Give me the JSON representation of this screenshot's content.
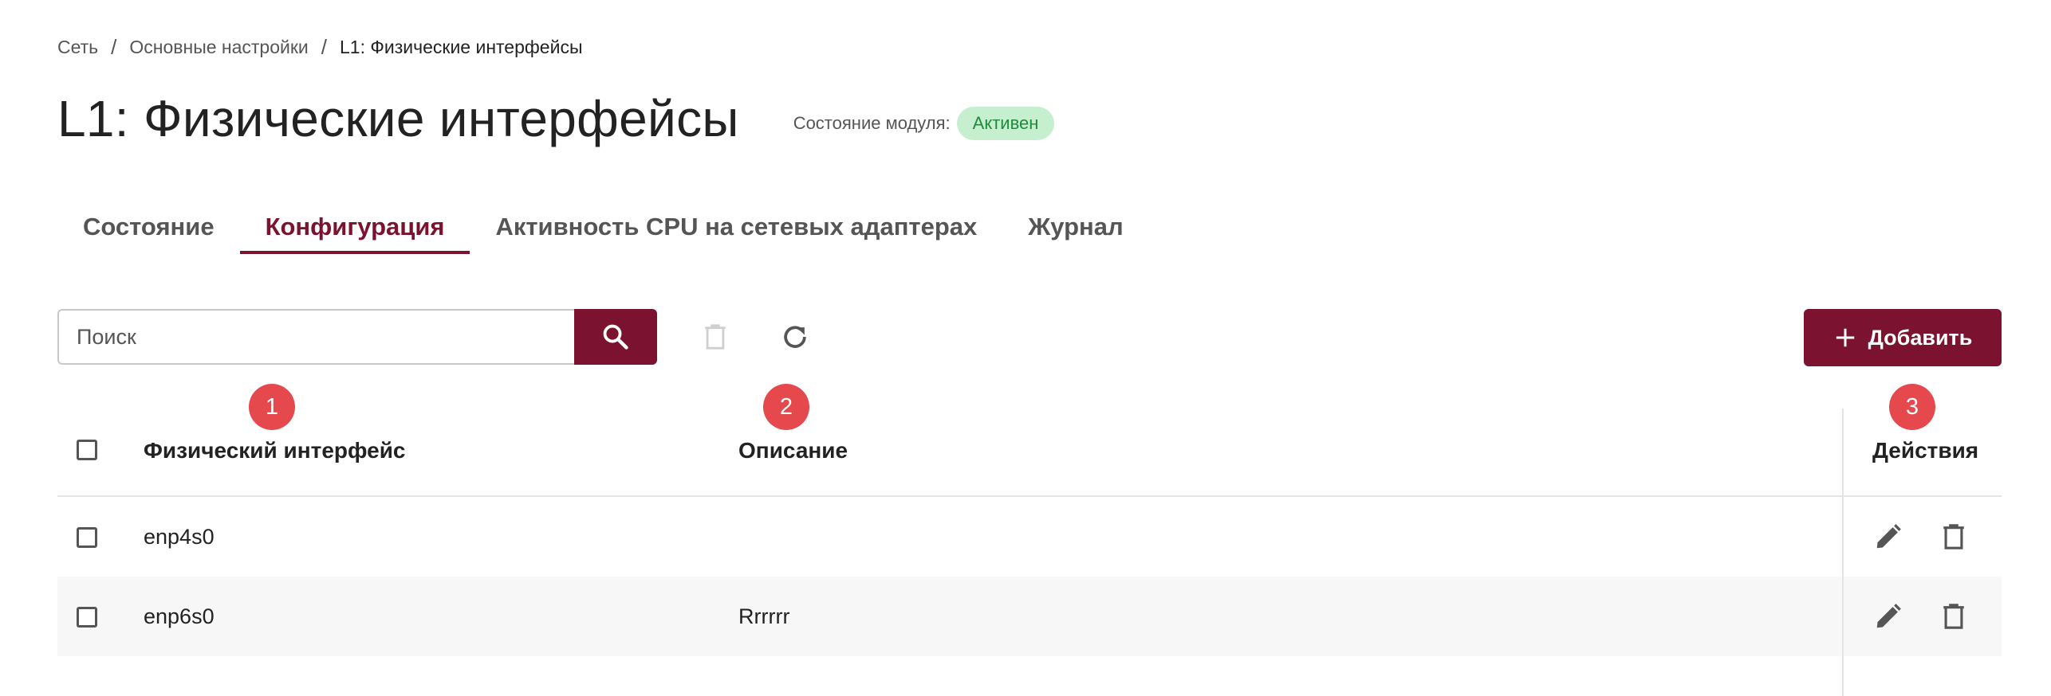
{
  "breadcrumb": {
    "item1": "Сеть",
    "sep": "/",
    "item2": "Основные настройки",
    "current": "L1: Физические интерфейсы"
  },
  "header": {
    "title": "L1: Физические интерфейсы",
    "module_state_label": "Состояние модуля:",
    "module_state_value": "Активен"
  },
  "tabs": [
    {
      "label": "Состояние",
      "active": false
    },
    {
      "label": "Конфигурация",
      "active": true
    },
    {
      "label": "Активность CPU на сетевых адаптерах",
      "active": false
    },
    {
      "label": "Журнал",
      "active": false
    }
  ],
  "toolbar": {
    "search_placeholder": "Поиск",
    "search_icon": "search-icon",
    "delete_icon": "trash-icon",
    "refresh_icon": "refresh-icon",
    "add_label": "Добавить",
    "add_icon": "plus-icon"
  },
  "markers": [
    "1",
    "2",
    "3"
  ],
  "table": {
    "columns": [
      "Физический интерфейс",
      "Описание",
      "Действия"
    ],
    "rows": [
      {
        "interface": "enp4s0",
        "description": ""
      },
      {
        "interface": "enp6s0",
        "description": "Rrrrrr"
      }
    ],
    "row_action_icons": [
      "pencil-icon",
      "trash-icon"
    ]
  },
  "colors": {
    "accent": "#7a1230",
    "badge_bg": "#c6efcf",
    "badge_text": "#1f8b3c",
    "marker": "#e5484d",
    "stripe": "#f7f7f7"
  }
}
